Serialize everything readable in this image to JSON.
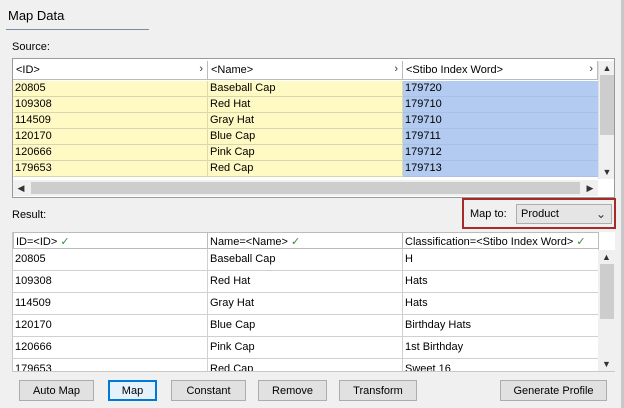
{
  "window": {
    "title": "Map Data"
  },
  "source": {
    "label": "Source:",
    "columns": [
      "<ID>",
      "<Name>",
      "<Stibo Index Word>"
    ],
    "rows": [
      [
        "20805",
        "Baseball Cap",
        "179720"
      ],
      [
        "109308",
        "Red Hat",
        "179710"
      ],
      [
        "114509",
        "Gray Hat",
        "179710"
      ],
      [
        "120170",
        "Blue Cap",
        "179711"
      ],
      [
        "120666",
        "Pink Cap",
        "179712"
      ],
      [
        "179653",
        "Red Cap",
        "179713"
      ]
    ]
  },
  "result": {
    "label": "Result:",
    "columns": [
      "ID=<ID>",
      "Name=<Name>",
      "Classification=<Stibo Index Word>"
    ],
    "rows": [
      [
        "20805",
        "Baseball Cap",
        "H"
      ],
      [
        "109308",
        "Red Hat",
        "Hats"
      ],
      [
        "114509",
        "Gray Hat",
        "Hats"
      ],
      [
        "120170",
        "Blue Cap",
        "Birthday Hats"
      ],
      [
        "120666",
        "Pink Cap",
        "1st Birthday"
      ],
      [
        "179653",
        "Red Cap",
        "Sweet 16"
      ]
    ]
  },
  "map_to": {
    "label": "Map to:",
    "value": "Product"
  },
  "buttons": {
    "auto_map": "Auto Map",
    "map": "Map",
    "constant": "Constant",
    "remove": "Remove",
    "transform": "Transform",
    "generate_profile": "Generate Profile"
  },
  "icons": {
    "header_arrow": "chevron-right-icon",
    "check": "checkmark-icon",
    "dropdown": "chevron-down-icon"
  },
  "colors": {
    "source_highlight_yellow": "#fff9c4",
    "source_highlight_blue": "#b3cbf0",
    "map_to_outline": "#a52a2a",
    "check_green": "#3a8a3a"
  }
}
